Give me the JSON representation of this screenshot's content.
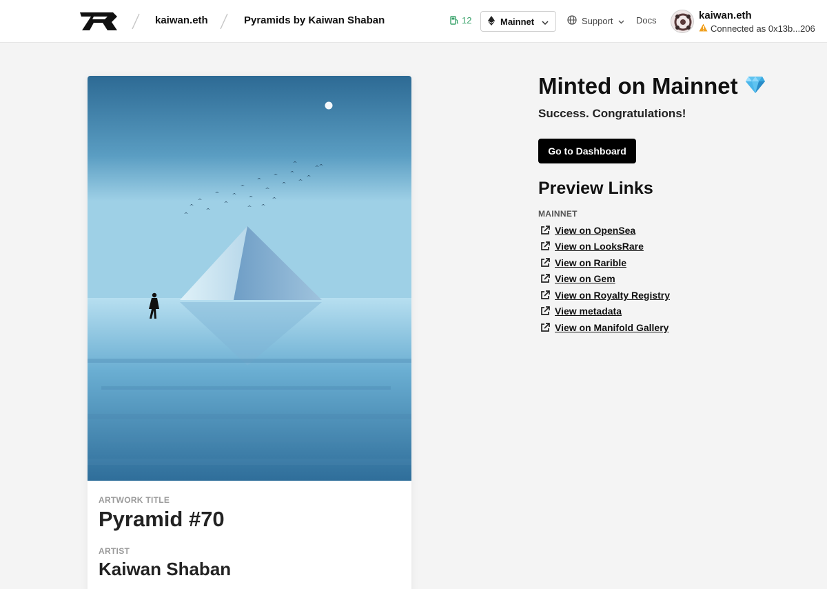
{
  "header": {
    "breadcrumb_user": "kaiwan.eth",
    "breadcrumb_collection": "Pyramids by Kaiwan Shaban",
    "gas_value": "12",
    "network_label": "Mainnet",
    "support_label": "Support",
    "docs_label": "Docs",
    "user_name": "kaiwan.eth",
    "connected_text": "Connected as 0x13b...206"
  },
  "artwork": {
    "title_label": "ARTWORK TITLE",
    "title": "Pyramid #70",
    "artist_label": "ARTIST",
    "artist": "Kaiwan Shaban"
  },
  "result": {
    "heading": "Minted on Mainnet",
    "heading_icon": "gem-icon",
    "message": "Success. Congratulations!",
    "dashboard_button": "Go to Dashboard"
  },
  "preview": {
    "heading": "Preview Links",
    "network_label": "MAINNET",
    "links": [
      "View on OpenSea",
      "View on LooksRare",
      "View on Rarible",
      "View on Gem",
      "View on Royalty Registry",
      "View metadata",
      "View on Manifold Gallery"
    ]
  },
  "colors": {
    "accent": "#000000",
    "gas": "#3aa36b",
    "warning": "#f0a020",
    "background": "#f4f4f4"
  }
}
